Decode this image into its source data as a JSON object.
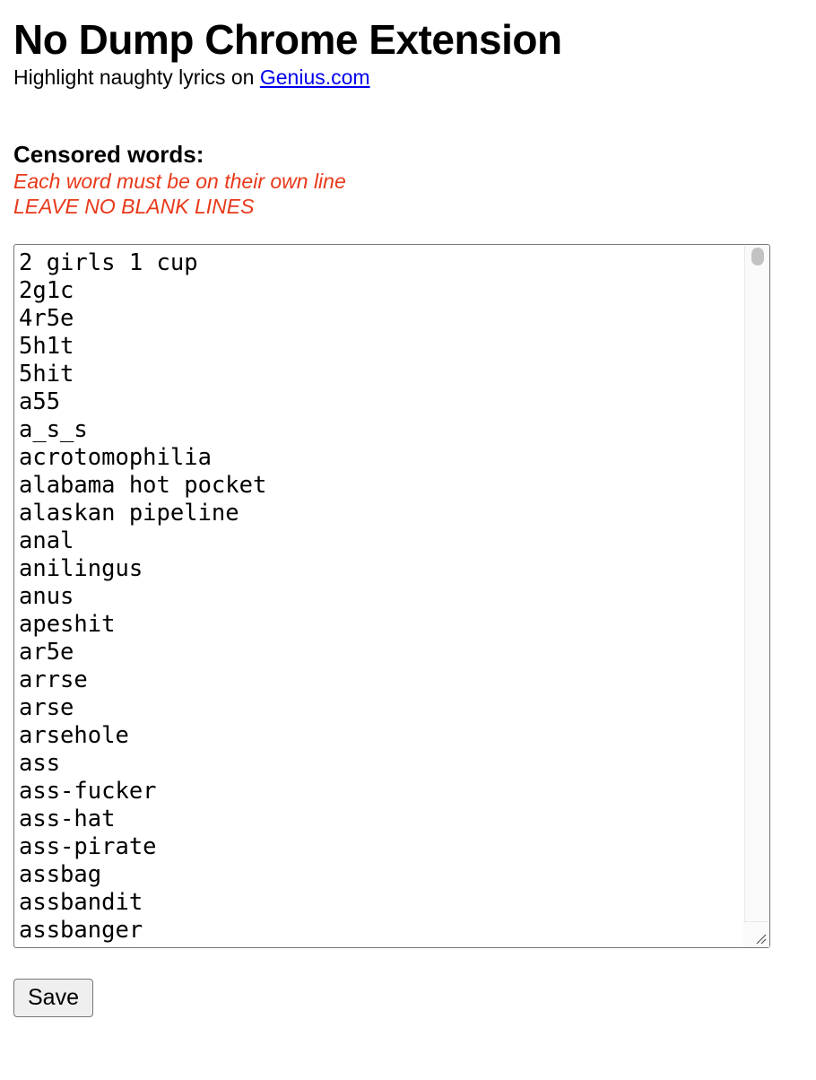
{
  "header": {
    "title": "No Dump Chrome Extension",
    "subtitle_prefix": "Highlight naughty lyrics on ",
    "link_text": "Genius.com"
  },
  "censored": {
    "heading": "Censored words:",
    "note_line1": "Each word must be on their own line",
    "note_line2": "LEAVE NO BLANK LINES",
    "note_color": "#e8391a",
    "words": [
      "2 girls 1 cup",
      "2g1c",
      "4r5e",
      "5h1t",
      "5hit",
      "a55",
      "a_s_s",
      "acrotomophilia",
      "alabama hot pocket",
      "alaskan pipeline",
      "anal",
      "anilingus",
      "anus",
      "apeshit",
      "ar5e",
      "arrse",
      "arse",
      "arsehole",
      "ass",
      "ass-fucker",
      "ass-hat",
      "ass-pirate",
      "assbag",
      "assbandit",
      "assbanger"
    ]
  },
  "actions": {
    "save_label": "Save"
  },
  "colors": {
    "link": "#0000ee",
    "text": "#000000",
    "button_bg": "#efefef",
    "border": "#767676"
  }
}
